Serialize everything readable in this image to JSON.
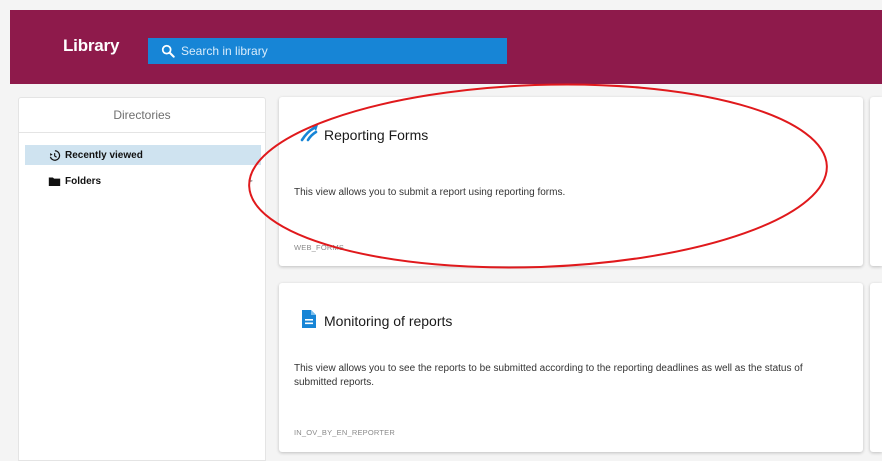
{
  "header": {
    "title": "Library",
    "search_placeholder": "Search in library",
    "background_color": "#8e1a4b",
    "search_color": "#1785d6"
  },
  "sidebar": {
    "title": "Directories",
    "items": [
      {
        "label": "Recently viewed",
        "icon": "history-icon",
        "active": true
      },
      {
        "label": "Folders",
        "icon": "folder-icon",
        "active": false
      }
    ]
  },
  "views": [
    {
      "title": "Reporting Forms",
      "description": "This view allows you to submit a report using reporting forms.",
      "code": "WEB_FORMS",
      "icon": "reporting-forms-icon"
    },
    {
      "title": "Monitoring of reports",
      "description": "This view allows you to see the reports to be submitted according to the reporting deadlines as well as the status of submitted reports.",
      "code": "IN_OV_BY_EN_REPORTER",
      "icon": "document-icon"
    }
  ],
  "annotation": {
    "shape": "ellipse",
    "color": "#e0191c"
  }
}
